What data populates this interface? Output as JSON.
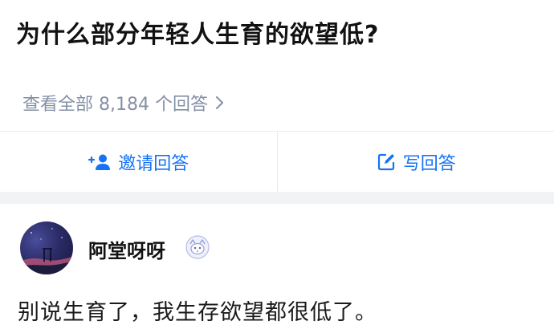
{
  "question": {
    "title": "为什么部分年轻人生育的欲望低?",
    "view_all": "查看全部 8,184 个回答"
  },
  "actions": {
    "invite_label": "邀请回答",
    "write_label": "写回答"
  },
  "answer": {
    "author": "阿堂呀呀",
    "text": "别说生育了，我生存欲望都很低了。"
  },
  "colors": {
    "accent": "#1772f6",
    "muted": "#8590a6",
    "band": "#f2f3f5"
  },
  "icons": {
    "view_all": "chevron-right-icon",
    "invite": "add-user-icon",
    "write": "edit-icon",
    "badge": "creator-badge-icon"
  }
}
